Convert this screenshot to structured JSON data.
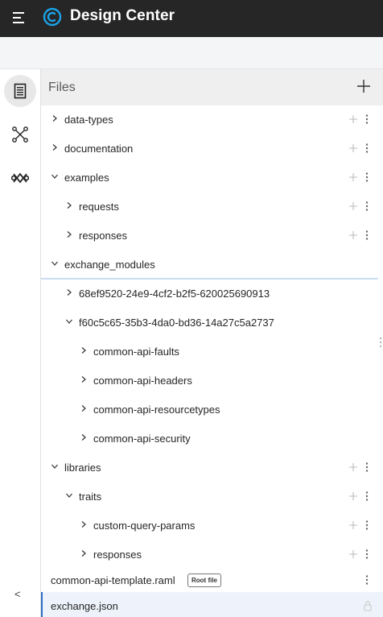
{
  "header": {
    "app_title": "Design Center",
    "menu_icon": "hamburger-menu-icon",
    "logo_icon": "design-center-logo-icon",
    "background": "#262626"
  },
  "rail": {
    "items": [
      {
        "name": "files",
        "icon": "file-document-icon",
        "active": true
      },
      {
        "name": "dependencies",
        "icon": "nodes-graph-icon",
        "active": false
      },
      {
        "name": "exchange",
        "icon": "exchange-icon",
        "active": false
      }
    ],
    "collapse_label": "<"
  },
  "files": {
    "title": "Files",
    "add_icon": "plus-icon",
    "rows": [
      {
        "label": "data-types",
        "chevron": ">",
        "actions": true
      },
      {
        "label": "documentation",
        "chevron": ">",
        "actions": true
      },
      {
        "label": "examples",
        "chevron": "v",
        "actions": true
      },
      {
        "label": "requests",
        "chevron": ">",
        "actions": true
      },
      {
        "label": "responses",
        "chevron": ">",
        "actions": true
      },
      {
        "label": "exchange_modules",
        "chevron": "v",
        "actions": false
      },
      {
        "label": "68ef9520-24e9-4cf2-b2f5-620025690913",
        "chevron": ">",
        "actions": false
      },
      {
        "label": "f60c5c65-35b3-4da0-bd36-14a27c5a2737",
        "chevron": "v",
        "actions": false
      },
      {
        "label": "common-api-faults",
        "chevron": ">",
        "actions": false
      },
      {
        "label": "common-api-headers",
        "chevron": ">",
        "actions": false
      },
      {
        "label": "common-api-resourcetypes",
        "chevron": ">",
        "actions": false
      },
      {
        "label": "common-api-security",
        "chevron": ">",
        "actions": false
      },
      {
        "label": "libraries",
        "chevron": "v",
        "actions": true
      },
      {
        "label": "traits",
        "chevron": "v",
        "actions": true
      },
      {
        "label": "custom-query-params",
        "chevron": ">",
        "actions": true
      },
      {
        "label": "responses",
        "chevron": ">",
        "actions": true
      },
      {
        "label": "common-api-template.raml",
        "badge": "Root file",
        "actions": "more-only"
      },
      {
        "label": "exchange.json",
        "selected": true,
        "lock_icon": "lock-icon"
      }
    ]
  },
  "colors": {
    "accent": "#2b6fc7",
    "selected_row": "#eef3fb",
    "separator": "#c9dcf1"
  }
}
